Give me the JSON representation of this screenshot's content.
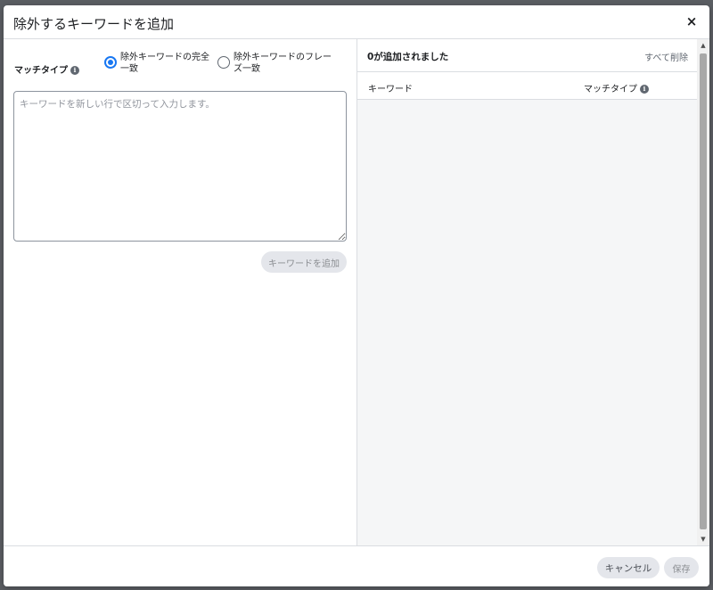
{
  "dialog": {
    "title": "除外するキーワードを追加",
    "close_icon": "×"
  },
  "left": {
    "match_type_label": "マッチタイプ",
    "info_icon": "i",
    "radios": [
      {
        "label": "除外キーワードの完全一致",
        "checked": true
      },
      {
        "label": "除外キーワードのフレーズ一致",
        "checked": false
      }
    ],
    "textarea_placeholder": "キーワードを新しい行で区切って入力します。",
    "add_keyword_button": "キーワードを追加"
  },
  "right": {
    "added_count_text": "0が追加されました",
    "delete_all": "すべて削除",
    "columns": {
      "keyword": "キーワード",
      "match_type": "マッチタイプ"
    },
    "rows": []
  },
  "footer": {
    "cancel_label": "キャンセル",
    "save_label": "保存"
  },
  "colors": {
    "accent": "#1877f2",
    "button_bg": "#e4e6eb",
    "panel_bg": "#f5f6f7"
  }
}
